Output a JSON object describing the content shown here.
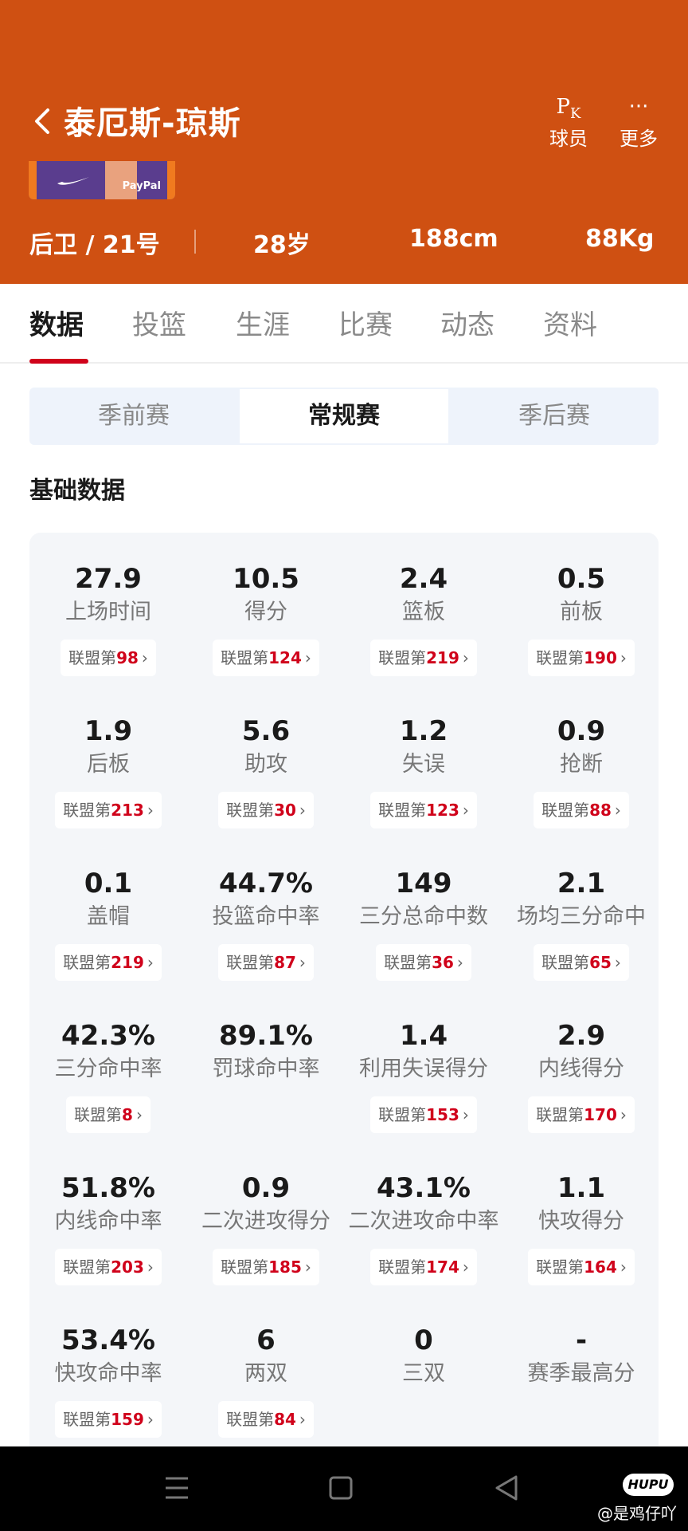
{
  "header": {
    "title": "泰厄斯-琼斯",
    "pk_label": "球员",
    "more_label": "更多",
    "jersey_brand": "PayPal",
    "position": "后卫 / 21号",
    "age": "28岁",
    "height": "188cm",
    "weight": "88Kg",
    "bg_color": "#cf5012"
  },
  "tabs": [
    "数据",
    "投篮",
    "生涯",
    "比赛",
    "动态",
    "资料"
  ],
  "season_types": [
    "季前赛",
    "常规赛",
    "季后赛"
  ],
  "section_title": "基础数据",
  "rank_prefix": "联盟第",
  "stats": [
    {
      "value": "27.9",
      "name": "上场时间",
      "rank": "98"
    },
    {
      "value": "10.5",
      "name": "得分",
      "rank": "124"
    },
    {
      "value": "2.4",
      "name": "篮板",
      "rank": "219"
    },
    {
      "value": "0.5",
      "name": "前板",
      "rank": "190"
    },
    {
      "value": "1.9",
      "name": "后板",
      "rank": "213"
    },
    {
      "value": "5.6",
      "name": "助攻",
      "rank": "30"
    },
    {
      "value": "1.2",
      "name": "失误",
      "rank": "123"
    },
    {
      "value": "0.9",
      "name": "抢断",
      "rank": "88"
    },
    {
      "value": "0.1",
      "name": "盖帽",
      "rank": "219"
    },
    {
      "value": "44.7%",
      "name": "投篮命中率",
      "rank": "87"
    },
    {
      "value": "149",
      "name": "三分总命中数",
      "rank": "36"
    },
    {
      "value": "2.1",
      "name": "场均三分命中",
      "rank": "65"
    },
    {
      "value": "42.3%",
      "name": "三分命中率",
      "rank": "8"
    },
    {
      "value": "89.1%",
      "name": "罚球命中率",
      "rank": ""
    },
    {
      "value": "1.4",
      "name": "利用失误得分",
      "rank": "153"
    },
    {
      "value": "2.9",
      "name": "内线得分",
      "rank": "170"
    },
    {
      "value": "51.8%",
      "name": "内线命中率",
      "rank": "203"
    },
    {
      "value": "0.9",
      "name": "二次进攻得分",
      "rank": "185"
    },
    {
      "value": "43.1%",
      "name": "二次进攻命中率",
      "rank": "174"
    },
    {
      "value": "1.1",
      "name": "快攻得分",
      "rank": "164"
    },
    {
      "value": "53.4%",
      "name": "快攻命中率",
      "rank": "159"
    },
    {
      "value": "6",
      "name": "两双",
      "rank": "84"
    },
    {
      "value": "0",
      "name": "三双",
      "rank": ""
    },
    {
      "value": "-",
      "name": "赛季最高分",
      "rank": ""
    }
  ],
  "watermark": {
    "logo": "HUPU",
    "text": "@是鸡仔吖"
  },
  "accent_color": "#d0021b"
}
